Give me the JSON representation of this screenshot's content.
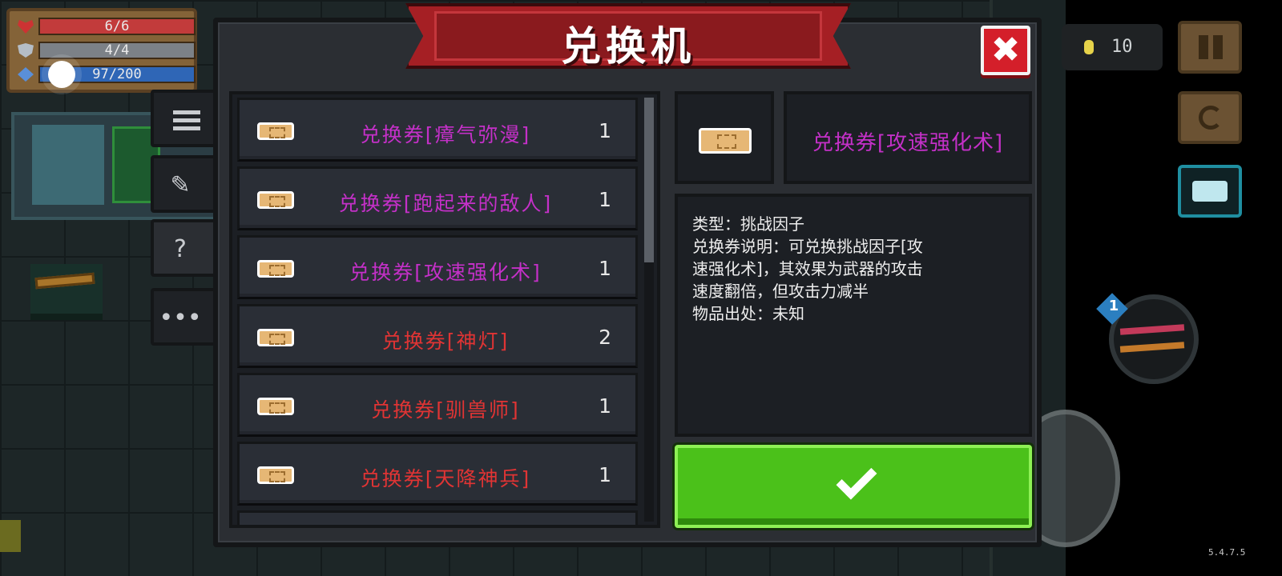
{
  "hud": {
    "hp": "6/6",
    "armor": "4/4",
    "energy": "97/200",
    "coins": "10",
    "version": "5.4.7.5",
    "weapon_slot_number": "1"
  },
  "modal": {
    "title": "兑换机",
    "close_label": "✖",
    "side_tabs": [
      {
        "name": "list",
        "icon": "list-icon"
      },
      {
        "name": "weapon",
        "icon": "weapon-icon"
      },
      {
        "name": "unknown",
        "icon": "question-icon",
        "glyph": "?"
      },
      {
        "name": "more",
        "icon": "more-icon",
        "glyph": "•••"
      }
    ],
    "items": [
      {
        "name": "兑换券[瘴气弥漫]",
        "count": "1",
        "color": "#c430c8"
      },
      {
        "name": "兑换券[跑起来的敌人]",
        "count": "1",
        "color": "#c430c8"
      },
      {
        "name": "兑换券[攻速强化术]",
        "count": "1",
        "color": "#c430c8"
      },
      {
        "name": "兑换券[神灯]",
        "count": "2",
        "color": "#e03434"
      },
      {
        "name": "兑换券[驯兽师]",
        "count": "1",
        "color": "#e03434"
      },
      {
        "name": "兑换券[天降神兵]",
        "count": "1",
        "color": "#e03434"
      }
    ],
    "detail": {
      "name": "兑换券[攻速强化术]",
      "lines": [
        "类型：挑战因子",
        "兑换券说明：可兑换挑战因子[攻",
        "速强化术]，其效果为武器的攻击",
        "速度翻倍，但攻击力减半",
        "物品出处：未知"
      ]
    }
  },
  "colors": {
    "epic": "#c430c8",
    "legendary": "#e03434",
    "confirm": "#4bc11a",
    "banner": "#a51f24"
  }
}
